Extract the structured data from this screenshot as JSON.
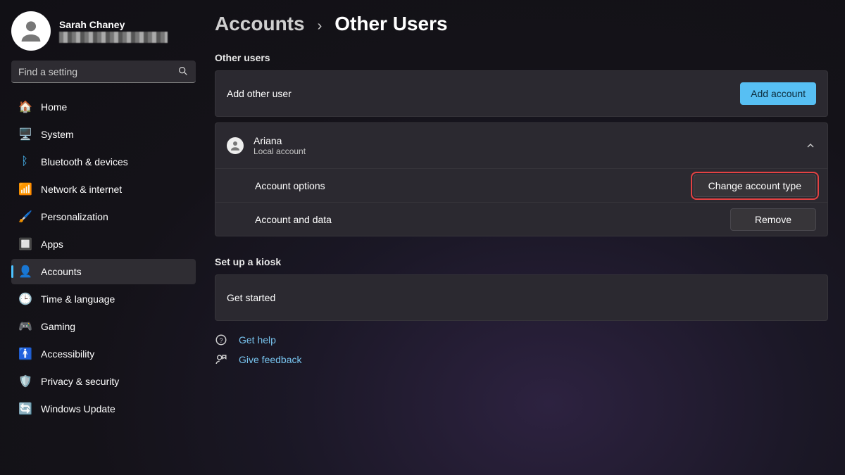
{
  "user": {
    "name": "Sarah Chaney"
  },
  "search": {
    "placeholder": "Find a setting"
  },
  "nav": {
    "items": [
      {
        "icon": "🏠",
        "label": "Home"
      },
      {
        "icon": "🖥️",
        "label": "System"
      },
      {
        "icon": "ᛒ",
        "label": "Bluetooth & devices"
      },
      {
        "icon": "📶",
        "label": "Network & internet"
      },
      {
        "icon": "🖌️",
        "label": "Personalization"
      },
      {
        "icon": "🔲",
        "label": "Apps"
      },
      {
        "icon": "👤",
        "label": "Accounts"
      },
      {
        "icon": "🕒",
        "label": "Time & language"
      },
      {
        "icon": "🎮",
        "label": "Gaming"
      },
      {
        "icon": "🚹",
        "label": "Accessibility"
      },
      {
        "icon": "🛡️",
        "label": "Privacy & security"
      },
      {
        "icon": "🔄",
        "label": "Windows Update"
      }
    ],
    "active_index": 6
  },
  "breadcrumb": {
    "parent": "Accounts",
    "current": "Other Users"
  },
  "sections": {
    "other_users": {
      "title": "Other users",
      "add_row": {
        "label": "Add other user",
        "button": "Add account"
      },
      "user": {
        "name": "Ariana",
        "type": "Local account",
        "options_label": "Account options",
        "options_button": "Change account type",
        "data_label": "Account and data",
        "data_button": "Remove"
      }
    },
    "kiosk": {
      "title": "Set up a kiosk",
      "row_label": "Get started"
    }
  },
  "links": {
    "help": "Get help",
    "feedback": "Give feedback"
  }
}
